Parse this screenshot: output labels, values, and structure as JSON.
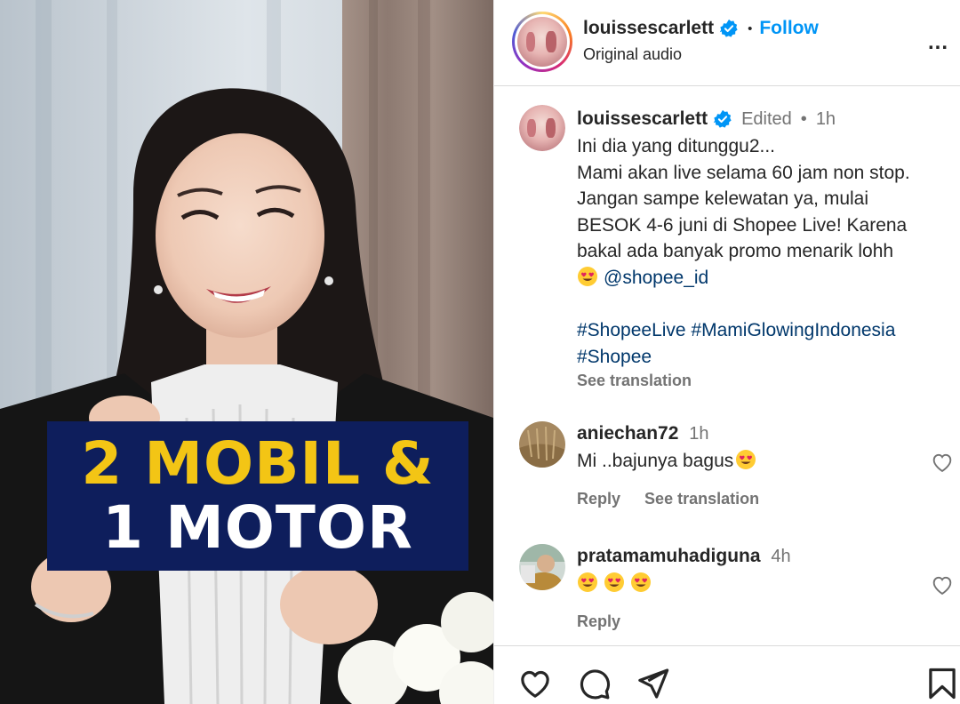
{
  "media": {
    "banner_line1": "2 MOBIL &",
    "banner_line2": "1 MOTOR",
    "banner_bg": "#0e1e5c",
    "banner_accent": "#f3c515"
  },
  "header": {
    "username": "louissescarlett",
    "follow_label": "Follow",
    "separator": "•",
    "audio_label": "Original audio",
    "more_label": "..."
  },
  "caption": {
    "username": "louissescarlett",
    "edited_label": "Edited",
    "separator": "•",
    "time": "1h",
    "lines": [
      "Ini dia yang ditunggu2...",
      "Mami akan live selama 60 jam non stop.",
      "Jangan sampe kelewatan ya, mulai",
      "BESOK 4-6 juni di Shopee Live! Karena",
      "bakal ada banyak promo menarik lohh"
    ],
    "mention": "@shopee_id",
    "hashtags_line1": "#ShopeeLive #MamiGlowingIndonesia",
    "hashtags_line2": "#Shopee",
    "see_translation": "See translation"
  },
  "comments": [
    {
      "username": "aniechan72",
      "time": "1h",
      "text": "Mi ..bajunya bagus",
      "actions": {
        "reply": "Reply",
        "translate": "See translation"
      }
    },
    {
      "username": "pratamamuhadiguna",
      "time": "4h",
      "text": "",
      "actions": {
        "reply": "Reply"
      }
    }
  ],
  "icons": {
    "verified": "verified-badge-icon",
    "emoji": "heart-eyes-emoji",
    "like": "heart-icon",
    "comment": "comment-icon",
    "share": "paper-plane-icon",
    "save": "bookmark-icon"
  },
  "colors": {
    "link_blue": "#0095f6",
    "tag_blue": "#00376b",
    "muted": "#737373"
  }
}
